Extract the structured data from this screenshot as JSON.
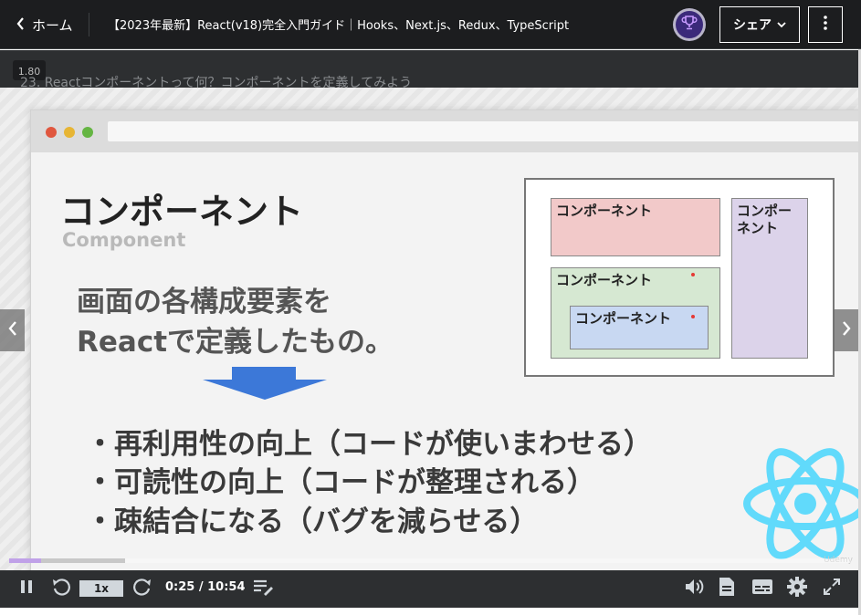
{
  "header": {
    "home_label": "ホーム",
    "course_title": "【2023年最新】React(v18)完全入門ガイド｜Hooks、Next.js、Redux、TypeScript",
    "share_label": "シェア",
    "icons": {
      "back": "chevron-left-icon",
      "trophy": "trophy-icon",
      "share_dropdown": "chevron-down-icon",
      "more": "more-vertical-icon"
    }
  },
  "lecture": {
    "speed_badge": "1.80",
    "title": "23. Reactコンポーネントって何？コンポーネントを定義してみよう"
  },
  "slide": {
    "title": "コンポーネント",
    "subtitle": "Component",
    "definition_lines": [
      "画面の各構成要素を",
      "Reactで定義したもの。"
    ],
    "bullets": [
      "・再利用性の向上（コードが使いまわせる）",
      "・可読性の向上（コードが整理される）",
      "・疎結合になる（バグを減らせる）"
    ],
    "diagram": {
      "box_top": "コンポーネント",
      "box_side": "コンポー\nネント",
      "box_middle": "コンポーネント",
      "box_inner": "コンポーネント"
    },
    "watermark": "Udemy",
    "colors": {
      "box_top": "#f2c9c9",
      "box_side": "#dcd3ea",
      "box_middle": "#d6e8d2",
      "box_inner": "#c8d8f2",
      "arrow": "#3c78d8",
      "react": "#61dafb"
    }
  },
  "player": {
    "progress_fraction": 0.038,
    "buffer_fraction": 0.138,
    "playback_rate": "1x",
    "time_display": "0:25 / 10:54",
    "progress_color": "#c0a1e8",
    "icons": {
      "pause": "pause-icon",
      "rewind": "rewind-5-icon",
      "forward": "forward-5-icon",
      "notes": "add-note-icon",
      "volume": "volume-icon",
      "transcript": "transcript-icon",
      "captions": "captions-icon",
      "settings": "gear-icon",
      "fullscreen": "fullscreen-icon",
      "prev": "chevron-left-icon",
      "next": "chevron-right-icon"
    }
  }
}
